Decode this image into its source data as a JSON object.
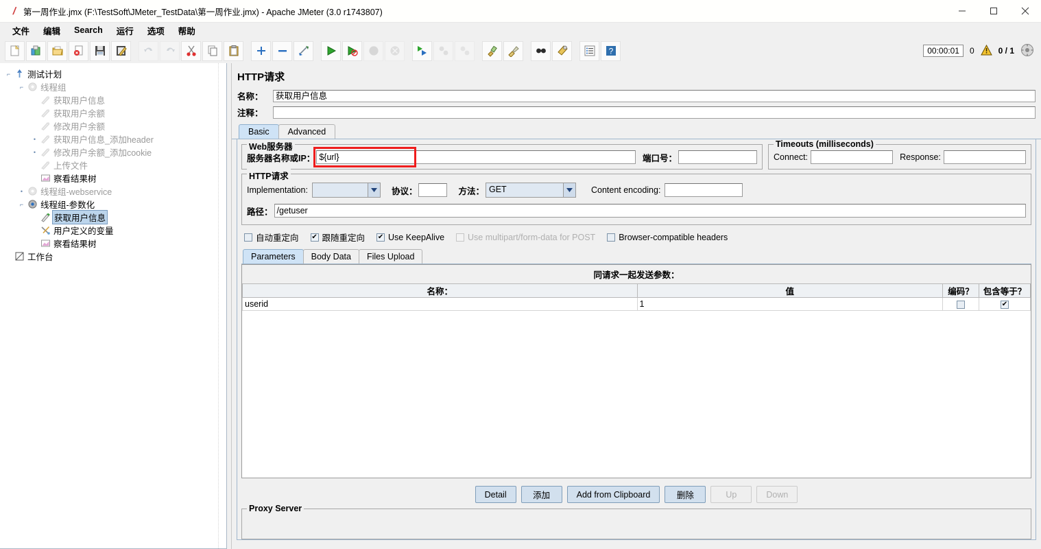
{
  "window": {
    "title": "第一周作业.jmx (F:\\TestSoft\\JMeter_TestData\\第一周作业.jmx) - Apache JMeter (3.0 r1743807)",
    "app_icon": "jmeter-feather-icon",
    "minimize": "—",
    "maximize": "▢",
    "close": "✕"
  },
  "menu": {
    "items": [
      "文件",
      "编辑",
      "Search",
      "运行",
      "选项",
      "帮助"
    ]
  },
  "toolbar": {
    "buttons": [
      {
        "name": "new-test-plan-icon",
        "enabled": true
      },
      {
        "name": "templates-icon",
        "enabled": true
      },
      {
        "name": "open-icon",
        "enabled": true
      },
      {
        "name": "close-icon",
        "enabled": true
      },
      {
        "name": "save-icon",
        "enabled": true
      },
      {
        "name": "save-as-icon",
        "enabled": true
      },
      {
        "name": "undo-icon",
        "enabled": false
      },
      {
        "name": "redo-icon",
        "enabled": false
      },
      {
        "name": "cut-icon",
        "enabled": true
      },
      {
        "name": "copy-icon",
        "enabled": true
      },
      {
        "name": "paste-icon",
        "enabled": true
      },
      {
        "name": "expand-all-icon",
        "enabled": true
      },
      {
        "name": "collapse-all-icon",
        "enabled": true
      },
      {
        "name": "toggle-icon",
        "enabled": true
      },
      {
        "name": "start-icon",
        "enabled": true
      },
      {
        "name": "start-no-pauses-icon",
        "enabled": true
      },
      {
        "name": "stop-icon",
        "enabled": false
      },
      {
        "name": "shutdown-icon",
        "enabled": false
      },
      {
        "name": "remote-start-all-icon",
        "enabled": true
      },
      {
        "name": "remote-stop-all-icon",
        "enabled": false
      },
      {
        "name": "remote-shutdown-all-icon",
        "enabled": false
      },
      {
        "name": "clear-icon",
        "enabled": true
      },
      {
        "name": "clear-all-icon",
        "enabled": true
      },
      {
        "name": "search-icon",
        "enabled": true
      },
      {
        "name": "search-reset-icon",
        "enabled": true
      },
      {
        "name": "function-helper-icon",
        "enabled": true
      },
      {
        "name": "help-icon",
        "enabled": true
      }
    ]
  },
  "status": {
    "elapsed": "00:00:01",
    "warning_count": "0",
    "warning_icon": "warning-triangle-icon",
    "threads": "0 / 1",
    "connection_icon": "remote-status-icon"
  },
  "tree": {
    "nodes": [
      {
        "label": "测试计划",
        "indent": 0,
        "icon": "test-plan-icon",
        "dim": false,
        "selected": false,
        "handle": "expanded"
      },
      {
        "label": "线程组",
        "indent": 1,
        "icon": "thread-group-icon",
        "dim": true,
        "selected": false,
        "handle": "expanded"
      },
      {
        "label": "获取用户信息",
        "indent": 2,
        "icon": "http-sampler-icon",
        "dim": true,
        "selected": false,
        "handle": "none"
      },
      {
        "label": "获取用户余额",
        "indent": 2,
        "icon": "http-sampler-icon",
        "dim": true,
        "selected": false,
        "handle": "none"
      },
      {
        "label": "修改用户余额",
        "indent": 2,
        "icon": "http-sampler-icon",
        "dim": true,
        "selected": false,
        "handle": "none"
      },
      {
        "label": "获取用户信息_添加header",
        "indent": 2,
        "icon": "http-sampler-icon",
        "dim": true,
        "selected": false,
        "handle": "collapsed"
      },
      {
        "label": "修改用户余额_添加cookie",
        "indent": 2,
        "icon": "http-sampler-icon",
        "dim": true,
        "selected": false,
        "handle": "collapsed"
      },
      {
        "label": "上传文件",
        "indent": 2,
        "icon": "http-sampler-icon",
        "dim": true,
        "selected": false,
        "handle": "none"
      },
      {
        "label": "察看结果树",
        "indent": 2,
        "icon": "view-results-tree-icon",
        "dim": false,
        "selected": false,
        "handle": "none"
      },
      {
        "label": "线程组-webservice",
        "indent": 1,
        "icon": "thread-group-icon",
        "dim": true,
        "selected": false,
        "handle": "collapsed"
      },
      {
        "label": "线程组-参数化",
        "indent": 1,
        "icon": "thread-group-active-icon",
        "dim": false,
        "selected": false,
        "handle": "expanded"
      },
      {
        "label": "获取用户信息",
        "indent": 2,
        "icon": "http-sampler-active-icon",
        "dim": false,
        "selected": true,
        "handle": "none"
      },
      {
        "label": "用户定义的变量",
        "indent": 2,
        "icon": "user-defined-variables-icon",
        "dim": false,
        "selected": false,
        "handle": "none"
      },
      {
        "label": "察看结果树",
        "indent": 2,
        "icon": "view-results-tree-icon",
        "dim": false,
        "selected": false,
        "handle": "none"
      },
      {
        "label": "工作台",
        "indent": 0,
        "icon": "workbench-icon",
        "dim": false,
        "selected": false,
        "handle": "none"
      }
    ]
  },
  "main": {
    "panel_title": "HTTP请求",
    "name_label": "名称：",
    "name_value": "获取用户信息",
    "comment_label": "注释：",
    "comment_value": "",
    "tabs": [
      {
        "label": "Basic",
        "active": true
      },
      {
        "label": "Advanced",
        "active": false
      }
    ],
    "web_server": {
      "group_label": "Web服务器",
      "server_label": "服务器名称或IP：",
      "server_value": "${url}",
      "port_label": "端口号：",
      "port_value": "",
      "highlight_color": "#ef1d1d"
    },
    "timeouts": {
      "group_label": "Timeouts (milliseconds)",
      "connect_label": "Connect:",
      "connect_value": "",
      "response_label": "Response:",
      "response_value": ""
    },
    "http_request": {
      "group_label": "HTTP请求",
      "implementation_label": "Implementation:",
      "implementation_value": "",
      "protocol_label": "协议：",
      "protocol_value": "",
      "method_label": "方法：",
      "method_value": "GET",
      "content_encoding_label": "Content encoding:",
      "content_encoding_value": "",
      "path_label": "路径：",
      "path_value": "/getuser"
    },
    "checkboxes": [
      {
        "label": "自动重定向",
        "checked": false,
        "enabled": true
      },
      {
        "label": "跟随重定向",
        "checked": true,
        "enabled": true
      },
      {
        "label": "Use KeepAlive",
        "checked": true,
        "enabled": true
      },
      {
        "label": "Use multipart/form-data for POST",
        "checked": false,
        "enabled": false
      },
      {
        "label": "Browser-compatible headers",
        "checked": false,
        "enabled": true
      }
    ],
    "param_tabs": [
      {
        "label": "Parameters",
        "active": true
      },
      {
        "label": "Body Data",
        "active": false
      },
      {
        "label": "Files Upload",
        "active": false
      }
    ],
    "table": {
      "caption": "同请求一起发送参数：",
      "columns": [
        "名称：",
        "值",
        "编码？",
        "包含等于？"
      ],
      "rows": [
        {
          "name": "userid",
          "value": "1",
          "encode": false,
          "include_equals": true
        }
      ]
    },
    "buttons": [
      {
        "label": "Detail",
        "enabled": true
      },
      {
        "label": "添加",
        "enabled": true
      },
      {
        "label": "Add from Clipboard",
        "enabled": true
      },
      {
        "label": "删除",
        "enabled": true
      },
      {
        "label": "Up",
        "enabled": false
      },
      {
        "label": "Down",
        "enabled": false
      }
    ],
    "proxy_group_label": "Proxy Server"
  }
}
